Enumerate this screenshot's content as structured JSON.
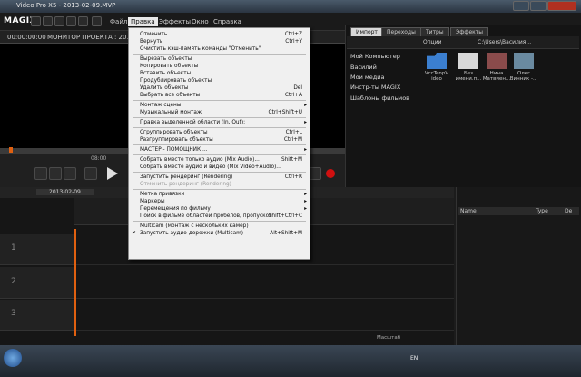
{
  "window": {
    "title": "Video Pro X5 - 2013-02-09.MVP"
  },
  "menubar": {
    "logo": "MAGIX",
    "items": [
      "Файл",
      "Правка",
      "Эффекты",
      "Окно",
      "Справка"
    ]
  },
  "preview": {
    "timecode": "00:00:00:00",
    "monitor_label": "МОНИТОР ПРОЕКТА : 2013-0",
    "ruler_time": "08:00"
  },
  "right_panel": {
    "tabs": [
      "Импорт",
      "Переходы",
      "Титры",
      "Эффекты"
    ],
    "options_label": "Опции",
    "path": "C:\\Users\\Василия...",
    "side_items": [
      "Мой Компьютер",
      "Василий",
      "Мои медиа",
      "Инстр-ты MAGIX",
      "Шаблоны фильмов"
    ],
    "tiles": [
      "VccTenpV ideo",
      "Без имени.п...",
      "Нина Матвиен...",
      "Олег Винник -..."
    ]
  },
  "timeline": {
    "project_tab": "2013-02-09",
    "tracks": [
      "1",
      "2",
      "3"
    ],
    "zoom": "Масштаб"
  },
  "right_lower": {
    "columns": [
      "Name",
      "Type",
      "De"
    ]
  },
  "taskbar": {
    "lang": "EN"
  },
  "edit_menu": {
    "rows": [
      {
        "label": "Отменить",
        "shortcut": "Ctrl+Z"
      },
      {
        "label": "Вернуть",
        "shortcut": "Ctrl+Y"
      },
      {
        "label": "Очистить кэш-память команды \"Отменить\"",
        "shortcut": ""
      },
      {
        "sep": true
      },
      {
        "label": "Вырезать объекты",
        "shortcut": ""
      },
      {
        "label": "Копировать объекты",
        "shortcut": ""
      },
      {
        "label": "Вставить объекты",
        "shortcut": ""
      },
      {
        "label": "Продублировать объекты",
        "shortcut": ""
      },
      {
        "label": "Удалить объекты",
        "shortcut": "Del"
      },
      {
        "label": "Выбрать все объекты",
        "shortcut": "Ctrl+A"
      },
      {
        "sep": true
      },
      {
        "label": "Монтаж сцены:",
        "submenu": true
      },
      {
        "label": "Музыкальный монтаж",
        "shortcut": "Ctrl+Shift+U"
      },
      {
        "sep": true
      },
      {
        "label": "Правка выделенной области (In, Out):",
        "submenu": true
      },
      {
        "sep": true
      },
      {
        "label": "Сгруппировать объекты",
        "shortcut": "Ctrl+L"
      },
      {
        "label": "Разгруппировать объекты",
        "shortcut": "Ctrl+M"
      },
      {
        "sep": true
      },
      {
        "label": "МАСТЕР - ПОМОЩНИК ...",
        "submenu": true
      },
      {
        "sep": true
      },
      {
        "label": "Собрать вместе только аудио (Mix Audio)...",
        "shortcut": "Shift+M"
      },
      {
        "label": "Собрать вместе аудио и видео (Mix Video+Audio)...",
        "shortcut": ""
      },
      {
        "sep": true
      },
      {
        "label": "Запустить рендеринг (Rendering)",
        "shortcut": "Ctrl+R"
      },
      {
        "label": "Отменить рендеринг (Rendering)",
        "shortcut": "",
        "disabled": true
      },
      {
        "sep": true
      },
      {
        "label": "Метка привязки",
        "submenu": true
      },
      {
        "label": "Маркеры",
        "submenu": true
      },
      {
        "label": "Перемещения по фильму",
        "submenu": true
      },
      {
        "label": "Поиск в фильме областей пробелов, пропусков",
        "shortcut": "Shift+Ctrl+C"
      },
      {
        "sep": true
      },
      {
        "label": "Multicam (монтаж с нескольких камер)",
        "shortcut": ""
      },
      {
        "label": "Запустить аудио-дорожки (Multicam)",
        "shortcut": "Alt+Shift+M",
        "checked": true
      }
    ]
  }
}
